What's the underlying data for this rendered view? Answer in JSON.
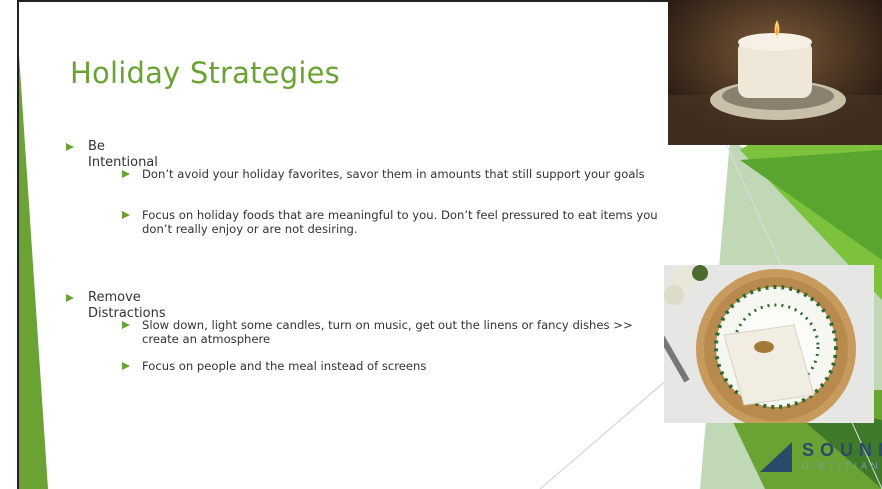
{
  "slide": {
    "title": "Holiday Strategies",
    "sections": [
      {
        "heading": "Be Intentional",
        "items": [
          "Don’t avoid your holiday favorites, savor them in amounts that still support your goals",
          "Focus on holiday foods that are meaningful to you. Don’t feel pressured to eat items you don’t really enjoy or are not desiring."
        ]
      },
      {
        "heading": "Remove Distractions",
        "items": [
          "Slow down, light some candles, turn on music, get out the linens or fancy dishes >> create an atmosphere",
          "Focus on people and the meal instead of screens"
        ]
      }
    ],
    "logo": {
      "line1": "SOUND",
      "line2": "DIETITIANS"
    }
  },
  "colors": {
    "accent": "#6aa334",
    "accent_dark": "#3f7a2a",
    "logo": "#2a4a6a"
  }
}
